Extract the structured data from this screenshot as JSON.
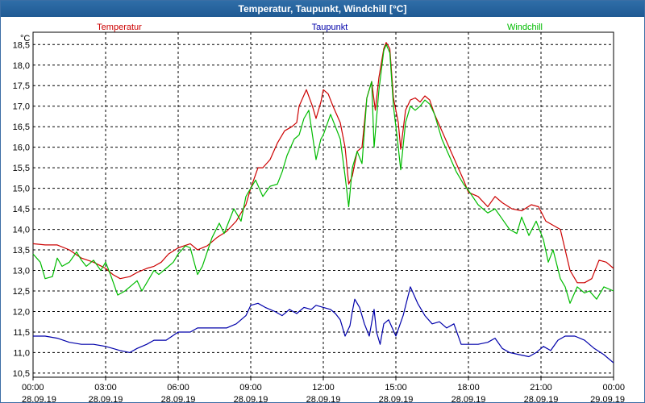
{
  "window": {
    "title": "Temperatur, Taupunkt, Windchill [°C]"
  },
  "chart_data": {
    "type": "line",
    "title": "Temperatur, Taupunkt, Windchill [°C]",
    "ylabel": "°C",
    "ylim": [
      10.4,
      18.8
    ],
    "yticks": [
      "10,5",
      "11,0",
      "11,5",
      "12,0",
      "12,5",
      "13,0",
      "13,5",
      "14,0",
      "14,5",
      "15,0",
      "15,5",
      "16,0",
      "16,5",
      "17,0",
      "17,5",
      "18,0",
      "18,5"
    ],
    "xlim": [
      0,
      24
    ],
    "xticks": [
      {
        "time": "00:00",
        "date": "28.09.19"
      },
      {
        "time": "03:00",
        "date": "28.09.19"
      },
      {
        "time": "06:00",
        "date": "28.09.19"
      },
      {
        "time": "09:00",
        "date": "28.09.19"
      },
      {
        "time": "12:00",
        "date": "28.09.19"
      },
      {
        "time": "15:00",
        "date": "28.09.19"
      },
      {
        "time": "18:00",
        "date": "28.09.19"
      },
      {
        "time": "21:00",
        "date": "28.09.19"
      },
      {
        "time": "00:00",
        "date": "29.09.19"
      }
    ],
    "grid": true,
    "legend_position": "top",
    "series": [
      {
        "name": "Temperatur",
        "color": "#cc0000",
        "points": [
          [
            0.0,
            13.65
          ],
          [
            0.5,
            13.62
          ],
          [
            1.0,
            13.62
          ],
          [
            1.5,
            13.5
          ],
          [
            2.0,
            13.3
          ],
          [
            2.5,
            13.2
          ],
          [
            3.0,
            13.05
          ],
          [
            3.3,
            12.9
          ],
          [
            3.6,
            12.8
          ],
          [
            4.0,
            12.85
          ],
          [
            4.3,
            12.95
          ],
          [
            4.7,
            13.05
          ],
          [
            5.0,
            13.1
          ],
          [
            5.3,
            13.2
          ],
          [
            5.6,
            13.4
          ],
          [
            6.0,
            13.55
          ],
          [
            6.5,
            13.65
          ],
          [
            6.8,
            13.5
          ],
          [
            7.2,
            13.6
          ],
          [
            7.6,
            13.8
          ],
          [
            8.0,
            13.95
          ],
          [
            8.4,
            14.2
          ],
          [
            8.8,
            14.6
          ],
          [
            9.0,
            15.0
          ],
          [
            9.3,
            15.5
          ],
          [
            9.5,
            15.5
          ],
          [
            9.8,
            15.7
          ],
          [
            10.1,
            16.1
          ],
          [
            10.4,
            16.4
          ],
          [
            10.7,
            16.5
          ],
          [
            10.9,
            16.6
          ],
          [
            11.0,
            17.0
          ],
          [
            11.3,
            17.4
          ],
          [
            11.55,
            17.0
          ],
          [
            11.7,
            16.7
          ],
          [
            11.9,
            17.1
          ],
          [
            12.0,
            17.4
          ],
          [
            12.2,
            17.3
          ],
          [
            12.4,
            17.0
          ],
          [
            12.7,
            16.6
          ],
          [
            12.9,
            16.0
          ],
          [
            13.05,
            15.1
          ],
          [
            13.2,
            15.3
          ],
          [
            13.4,
            15.9
          ],
          [
            13.6,
            16.0
          ],
          [
            13.8,
            17.2
          ],
          [
            14.0,
            17.6
          ],
          [
            14.15,
            16.9
          ],
          [
            14.3,
            17.7
          ],
          [
            14.5,
            18.4
          ],
          [
            14.6,
            18.55
          ],
          [
            14.75,
            18.4
          ],
          [
            14.9,
            17.2
          ],
          [
            15.1,
            16.6
          ],
          [
            15.2,
            15.95
          ],
          [
            15.4,
            16.9
          ],
          [
            15.6,
            17.15
          ],
          [
            15.8,
            17.2
          ],
          [
            16.0,
            17.1
          ],
          [
            16.2,
            17.25
          ],
          [
            16.4,
            17.15
          ],
          [
            16.6,
            16.8
          ],
          [
            16.9,
            16.4
          ],
          [
            17.2,
            16.0
          ],
          [
            17.5,
            15.6
          ],
          [
            17.8,
            15.2
          ],
          [
            18.0,
            14.9
          ],
          [
            18.4,
            14.8
          ],
          [
            18.8,
            14.55
          ],
          [
            19.1,
            14.8
          ],
          [
            19.4,
            14.65
          ],
          [
            19.8,
            14.5
          ],
          [
            20.2,
            14.45
          ],
          [
            20.6,
            14.6
          ],
          [
            20.9,
            14.55
          ],
          [
            21.2,
            14.2
          ],
          [
            21.5,
            14.1
          ],
          [
            21.8,
            14.0
          ],
          [
            22.0,
            13.5
          ],
          [
            22.2,
            13.0
          ],
          [
            22.5,
            12.7
          ],
          [
            22.8,
            12.7
          ],
          [
            23.1,
            12.8
          ],
          [
            23.4,
            13.25
          ],
          [
            23.7,
            13.2
          ],
          [
            24.0,
            13.05
          ]
        ]
      },
      {
        "name": "Taupunkt",
        "color": "#0000aa",
        "points": [
          [
            0.0,
            11.4
          ],
          [
            0.5,
            11.4
          ],
          [
            1.0,
            11.35
          ],
          [
            1.5,
            11.25
          ],
          [
            2.0,
            11.2
          ],
          [
            2.5,
            11.2
          ],
          [
            3.0,
            11.15
          ],
          [
            3.3,
            11.1
          ],
          [
            3.6,
            11.05
          ],
          [
            4.0,
            11.0
          ],
          [
            4.3,
            11.1
          ],
          [
            4.7,
            11.2
          ],
          [
            5.0,
            11.3
          ],
          [
            5.5,
            11.3
          ],
          [
            6.0,
            11.5
          ],
          [
            6.5,
            11.5
          ],
          [
            6.8,
            11.6
          ],
          [
            7.2,
            11.6
          ],
          [
            7.6,
            11.6
          ],
          [
            8.0,
            11.6
          ],
          [
            8.4,
            11.7
          ],
          [
            8.8,
            11.9
          ],
          [
            9.0,
            12.15
          ],
          [
            9.3,
            12.2
          ],
          [
            9.6,
            12.1
          ],
          [
            10.0,
            12.0
          ],
          [
            10.3,
            11.9
          ],
          [
            10.6,
            12.05
          ],
          [
            10.9,
            11.95
          ],
          [
            11.2,
            12.1
          ],
          [
            11.5,
            12.05
          ],
          [
            11.7,
            12.15
          ],
          [
            12.0,
            12.1
          ],
          [
            12.3,
            12.05
          ],
          [
            12.5,
            11.95
          ],
          [
            12.7,
            11.8
          ],
          [
            12.9,
            11.4
          ],
          [
            13.1,
            11.65
          ],
          [
            13.2,
            12.0
          ],
          [
            13.3,
            12.3
          ],
          [
            13.5,
            12.1
          ],
          [
            13.7,
            11.7
          ],
          [
            13.9,
            11.4
          ],
          [
            14.1,
            12.05
          ],
          [
            14.2,
            11.5
          ],
          [
            14.35,
            11.2
          ],
          [
            14.5,
            11.7
          ],
          [
            14.7,
            11.8
          ],
          [
            14.85,
            11.6
          ],
          [
            15.0,
            11.4
          ],
          [
            15.3,
            11.9
          ],
          [
            15.6,
            12.6
          ],
          [
            15.9,
            12.2
          ],
          [
            16.2,
            11.9
          ],
          [
            16.5,
            11.7
          ],
          [
            16.8,
            11.75
          ],
          [
            17.1,
            11.6
          ],
          [
            17.4,
            11.7
          ],
          [
            17.7,
            11.2
          ],
          [
            18.0,
            11.2
          ],
          [
            18.4,
            11.2
          ],
          [
            18.8,
            11.25
          ],
          [
            19.1,
            11.35
          ],
          [
            19.4,
            11.1
          ],
          [
            19.7,
            11.0
          ],
          [
            20.1,
            10.95
          ],
          [
            20.5,
            10.9
          ],
          [
            20.8,
            11.0
          ],
          [
            21.1,
            11.15
          ],
          [
            21.4,
            11.05
          ],
          [
            21.7,
            11.3
          ],
          [
            22.0,
            11.4
          ],
          [
            22.4,
            11.4
          ],
          [
            22.8,
            11.3
          ],
          [
            23.2,
            11.1
          ],
          [
            23.6,
            10.95
          ],
          [
            24.0,
            10.75
          ]
        ]
      },
      {
        "name": "Windchill",
        "color": "#00bb00",
        "points": [
          [
            0.0,
            13.4
          ],
          [
            0.3,
            13.2
          ],
          [
            0.5,
            12.8
          ],
          [
            0.8,
            12.85
          ],
          [
            1.0,
            13.3
          ],
          [
            1.2,
            13.1
          ],
          [
            1.5,
            13.2
          ],
          [
            1.8,
            13.45
          ],
          [
            2.0,
            13.25
          ],
          [
            2.2,
            13.1
          ],
          [
            2.5,
            13.25
          ],
          [
            2.8,
            13.0
          ],
          [
            3.0,
            13.2
          ],
          [
            3.2,
            12.9
          ],
          [
            3.5,
            12.4
          ],
          [
            3.8,
            12.5
          ],
          [
            4.0,
            12.6
          ],
          [
            4.3,
            12.75
          ],
          [
            4.5,
            12.5
          ],
          [
            4.7,
            12.7
          ],
          [
            5.0,
            13.0
          ],
          [
            5.2,
            12.9
          ],
          [
            5.5,
            13.05
          ],
          [
            5.8,
            13.2
          ],
          [
            6.0,
            13.4
          ],
          [
            6.3,
            13.6
          ],
          [
            6.5,
            13.55
          ],
          [
            6.8,
            12.9
          ],
          [
            7.0,
            13.1
          ],
          [
            7.2,
            13.45
          ],
          [
            7.4,
            13.8
          ],
          [
            7.7,
            14.15
          ],
          [
            7.9,
            13.9
          ],
          [
            8.1,
            14.2
          ],
          [
            8.3,
            14.5
          ],
          [
            8.6,
            14.2
          ],
          [
            8.8,
            14.8
          ],
          [
            9.0,
            15.0
          ],
          [
            9.2,
            15.2
          ],
          [
            9.5,
            14.8
          ],
          [
            9.8,
            15.05
          ],
          [
            10.1,
            15.1
          ],
          [
            10.3,
            15.4
          ],
          [
            10.5,
            15.8
          ],
          [
            10.8,
            16.2
          ],
          [
            11.0,
            16.3
          ],
          [
            11.2,
            16.7
          ],
          [
            11.4,
            16.9
          ],
          [
            11.55,
            16.3
          ],
          [
            11.7,
            15.7
          ],
          [
            11.9,
            16.2
          ],
          [
            12.0,
            16.3
          ],
          [
            12.3,
            16.8
          ],
          [
            12.5,
            16.5
          ],
          [
            12.7,
            16.2
          ],
          [
            12.9,
            15.3
          ],
          [
            13.05,
            14.55
          ],
          [
            13.2,
            15.5
          ],
          [
            13.4,
            15.9
          ],
          [
            13.6,
            15.6
          ],
          [
            13.8,
            17.2
          ],
          [
            14.0,
            17.6
          ],
          [
            14.1,
            16.0
          ],
          [
            14.3,
            17.4
          ],
          [
            14.5,
            18.35
          ],
          [
            14.6,
            18.5
          ],
          [
            14.75,
            18.3
          ],
          [
            14.9,
            17.0
          ],
          [
            15.1,
            16.0
          ],
          [
            15.2,
            15.45
          ],
          [
            15.4,
            16.6
          ],
          [
            15.6,
            17.0
          ],
          [
            15.8,
            16.9
          ],
          [
            16.0,
            17.0
          ],
          [
            16.2,
            17.15
          ],
          [
            16.4,
            17.05
          ],
          [
            16.6,
            16.8
          ],
          [
            16.9,
            16.2
          ],
          [
            17.2,
            15.8
          ],
          [
            17.5,
            15.4
          ],
          [
            17.8,
            15.1
          ],
          [
            18.0,
            14.95
          ],
          [
            18.4,
            14.6
          ],
          [
            18.8,
            14.4
          ],
          [
            19.1,
            14.5
          ],
          [
            19.4,
            14.25
          ],
          [
            19.7,
            14.0
          ],
          [
            20.0,
            13.9
          ],
          [
            20.2,
            14.3
          ],
          [
            20.5,
            13.85
          ],
          [
            20.8,
            14.2
          ],
          [
            21.1,
            13.75
          ],
          [
            21.3,
            13.2
          ],
          [
            21.5,
            13.5
          ],
          [
            21.8,
            12.8
          ],
          [
            22.0,
            12.6
          ],
          [
            22.2,
            12.2
          ],
          [
            22.5,
            12.6
          ],
          [
            22.8,
            12.45
          ],
          [
            23.0,
            12.5
          ],
          [
            23.3,
            12.3
          ],
          [
            23.6,
            12.6
          ],
          [
            24.0,
            12.5
          ]
        ]
      }
    ]
  }
}
